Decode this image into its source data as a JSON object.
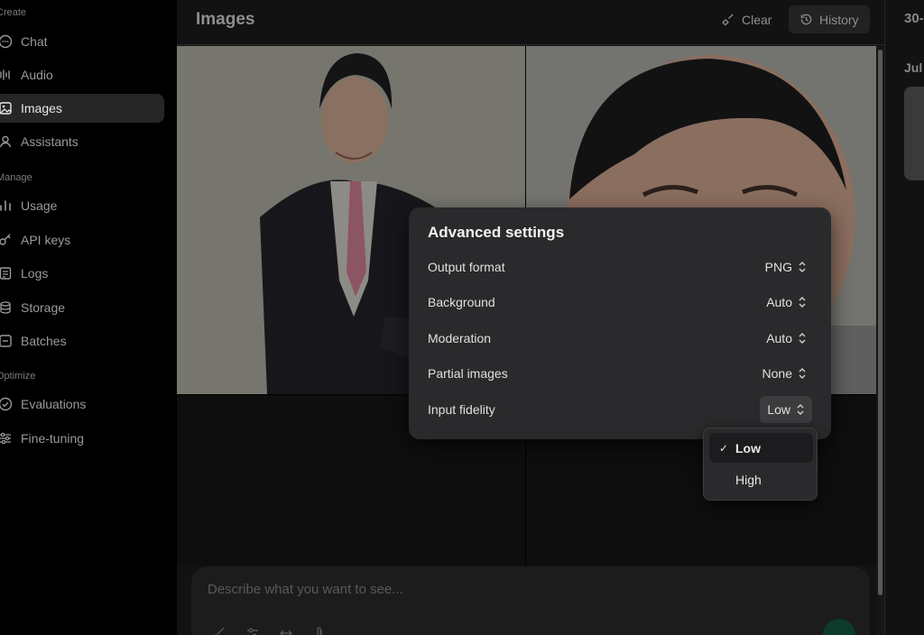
{
  "sidebar": {
    "sections": [
      {
        "label": "Create"
      },
      {
        "label": "Manage"
      },
      {
        "label": "Optimize"
      }
    ],
    "items": [
      {
        "label": "Chat",
        "icon": "chat-icon"
      },
      {
        "label": "Audio",
        "icon": "audio-icon"
      },
      {
        "label": "Images",
        "icon": "image-icon",
        "active": true
      },
      {
        "label": "Assistants",
        "icon": "assistants-icon"
      },
      {
        "label": "Usage",
        "icon": "usage-icon"
      },
      {
        "label": "API keys",
        "icon": "key-icon"
      },
      {
        "label": "Logs",
        "icon": "logs-icon"
      },
      {
        "label": "Storage",
        "icon": "storage-icon"
      },
      {
        "label": "Batches",
        "icon": "batches-icon"
      },
      {
        "label": "Evaluations",
        "icon": "evaluations-icon"
      },
      {
        "label": "Fine-tuning",
        "icon": "fine-tuning-icon"
      }
    ]
  },
  "header": {
    "title": "Images",
    "clear_label": "Clear",
    "history_label": "History"
  },
  "right_panel": {
    "top_text": "30-",
    "date_text": "Jul"
  },
  "composer": {
    "placeholder": "Describe what you want to see..."
  },
  "advanced_settings": {
    "title": "Advanced settings",
    "rows": [
      {
        "label": "Output format",
        "value": "PNG"
      },
      {
        "label": "Background",
        "value": "Auto"
      },
      {
        "label": "Moderation",
        "value": "Auto"
      },
      {
        "label": "Partial images",
        "value": "None"
      },
      {
        "label": "Input fidelity",
        "value": "Low"
      }
    ]
  },
  "fidelity_dropdown": {
    "options": [
      {
        "label": "Low",
        "selected": true
      },
      {
        "label": "High",
        "selected": false
      }
    ],
    "check_glyph": "✓"
  },
  "colors": {
    "accent_send": "#0c3b2b",
    "popover_bg": "#2a2a2c",
    "sidebar_active": "#262626"
  }
}
